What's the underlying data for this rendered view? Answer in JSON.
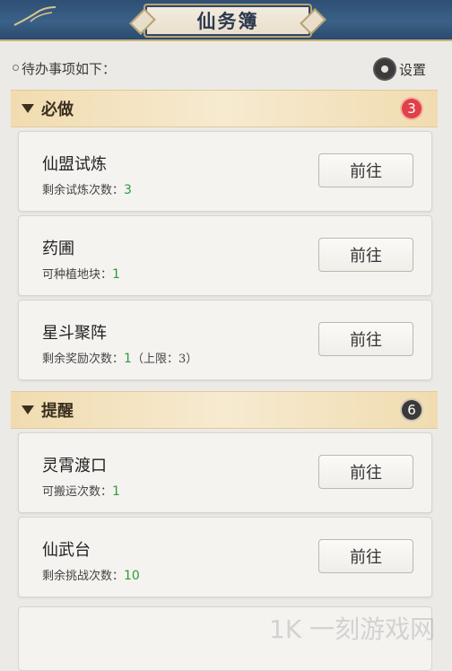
{
  "header": {
    "title": "仙务簿"
  },
  "intro": {
    "label": "待办事项如下："
  },
  "settings": {
    "label": "设置"
  },
  "sections": [
    {
      "title": "必做",
      "badge": "3",
      "badge_color": "#e0404a",
      "items": [
        {
          "name": "仙盟试炼",
          "sub_prefix": "剩余试炼次数：",
          "count": "3",
          "sub_suffix": "",
          "button": "前往"
        },
        {
          "name": "药圃",
          "sub_prefix": "可种植地块：",
          "count": "1",
          "sub_suffix": "",
          "button": "前往"
        },
        {
          "name": "星斗聚阵",
          "sub_prefix": "剩余奖励次数：",
          "count": "1",
          "sub_suffix": "（上限：3）",
          "button": "前往"
        }
      ]
    },
    {
      "title": "提醒",
      "badge": "6",
      "badge_color": "#3a3a3a",
      "items": [
        {
          "name": "灵霄渡口",
          "sub_prefix": "可搬运次数：",
          "count": "1",
          "sub_suffix": "",
          "button": "前往"
        },
        {
          "name": "仙武台",
          "sub_prefix": "剩余挑战次数：",
          "count": "10",
          "sub_suffix": "",
          "button": "前往"
        }
      ]
    }
  ],
  "watermark": "1K 一刻游戏网",
  "colors": {
    "count_green": "#2e9a3a",
    "header_blue": "#34577d",
    "section_gold": "#f1dcb0"
  },
  "icons": {
    "settings": "gear-icon",
    "collapse": "triangle-down-icon",
    "logo": "bird-icon"
  }
}
